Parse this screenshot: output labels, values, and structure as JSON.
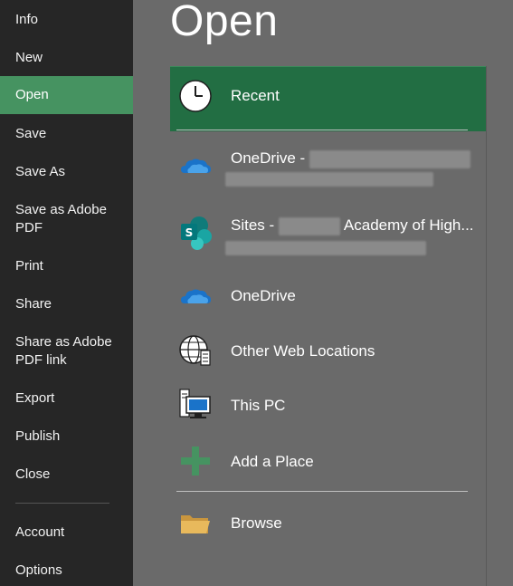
{
  "sidebar": {
    "items": [
      {
        "label": "Info"
      },
      {
        "label": "New"
      },
      {
        "label": "Open"
      },
      {
        "label": "Save"
      },
      {
        "label": "Save As"
      },
      {
        "label": "Save as Adobe PDF"
      },
      {
        "label": "Print"
      },
      {
        "label": "Share"
      },
      {
        "label": "Share as Adobe PDF link"
      },
      {
        "label": "Export"
      },
      {
        "label": "Publish"
      },
      {
        "label": "Close"
      },
      {
        "label": "Account"
      },
      {
        "label": "Options"
      }
    ],
    "selected": "Open"
  },
  "main": {
    "title": "Open",
    "places": [
      {
        "label": "Recent",
        "icon": "clock-icon"
      },
      {
        "label_prefix": "OneDrive - ",
        "icon": "onedrive-icon"
      },
      {
        "label_prefix": "Sites - ",
        "label_suffix": "Academy of High...",
        "icon": "sharepoint-icon"
      },
      {
        "label": "OneDrive",
        "icon": "onedrive-icon"
      },
      {
        "label": "Other Web Locations",
        "icon": "globe-icon"
      },
      {
        "label": "This PC",
        "icon": "computer-icon"
      },
      {
        "label": "Add a Place",
        "icon": "plus-icon"
      },
      {
        "label": "Browse",
        "icon": "folder-icon"
      }
    ]
  },
  "colors": {
    "sidebar_bg": "#262626",
    "sidebar_selected": "#469361",
    "main_bg": "#6a6a6a",
    "recent_selected": "#226e43",
    "onedrive_blue": "#1a73c9",
    "sharepoint_teal": "#0f7b7a",
    "plus_green": "#469361",
    "folder_tan": "#e8b95c"
  }
}
